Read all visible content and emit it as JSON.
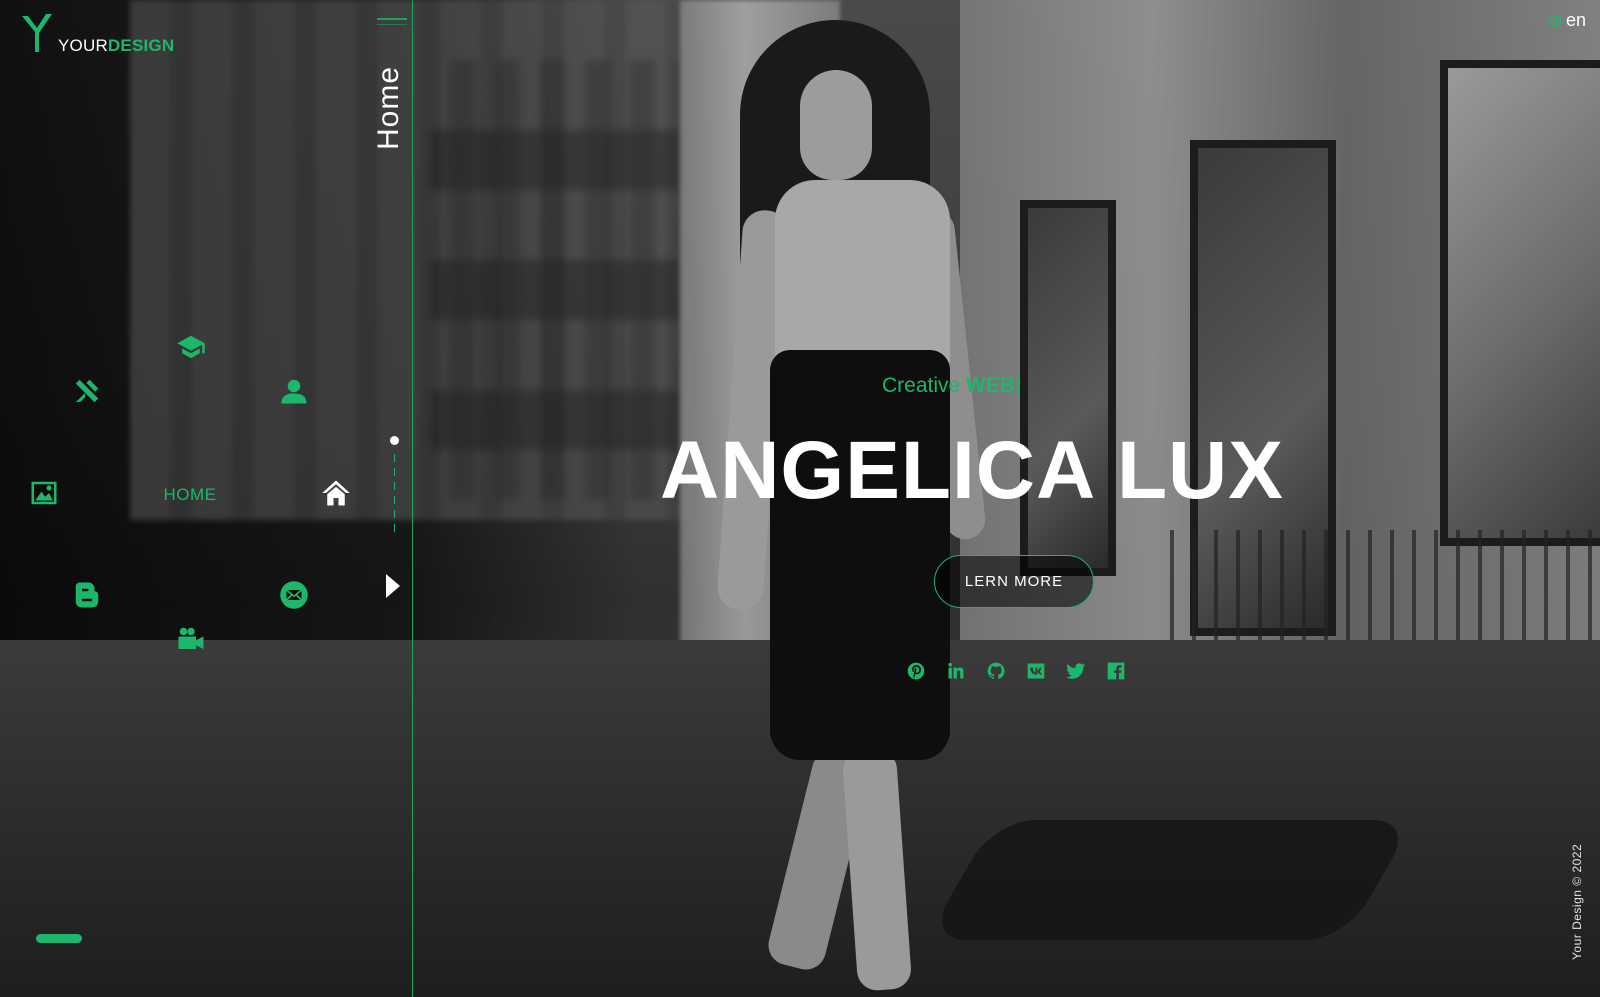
{
  "logo": {
    "part1": "YOUR",
    "part2": "DESIGN"
  },
  "page_label": "Home",
  "lang": "en",
  "menu": {
    "home_label": "HOME",
    "items": [
      {
        "name": "education",
        "icon": "graduation-cap-icon"
      },
      {
        "name": "skills",
        "icon": "tools-icon"
      },
      {
        "name": "about",
        "icon": "user-icon"
      },
      {
        "name": "portfolio",
        "icon": "image-icon"
      },
      {
        "name": "home",
        "icon": "home-icon"
      },
      {
        "name": "blog",
        "icon": "blogger-icon"
      },
      {
        "name": "contact",
        "icon": "envelope-icon"
      },
      {
        "name": "video",
        "icon": "video-camera-icon"
      }
    ]
  },
  "hero": {
    "subtitle_prefix": "Creative",
    "subtitle_word": "WEB",
    "title": "ANGELICA LUX",
    "button_label": "LERN MORE"
  },
  "socials": [
    "pinterest-icon",
    "linkedin-icon",
    "github-icon",
    "vk-icon",
    "twitter-icon",
    "facebook-icon"
  ],
  "copyright": "Your Design © 2022",
  "colors": {
    "accent": "#1db76b",
    "text": "#ffffff"
  }
}
